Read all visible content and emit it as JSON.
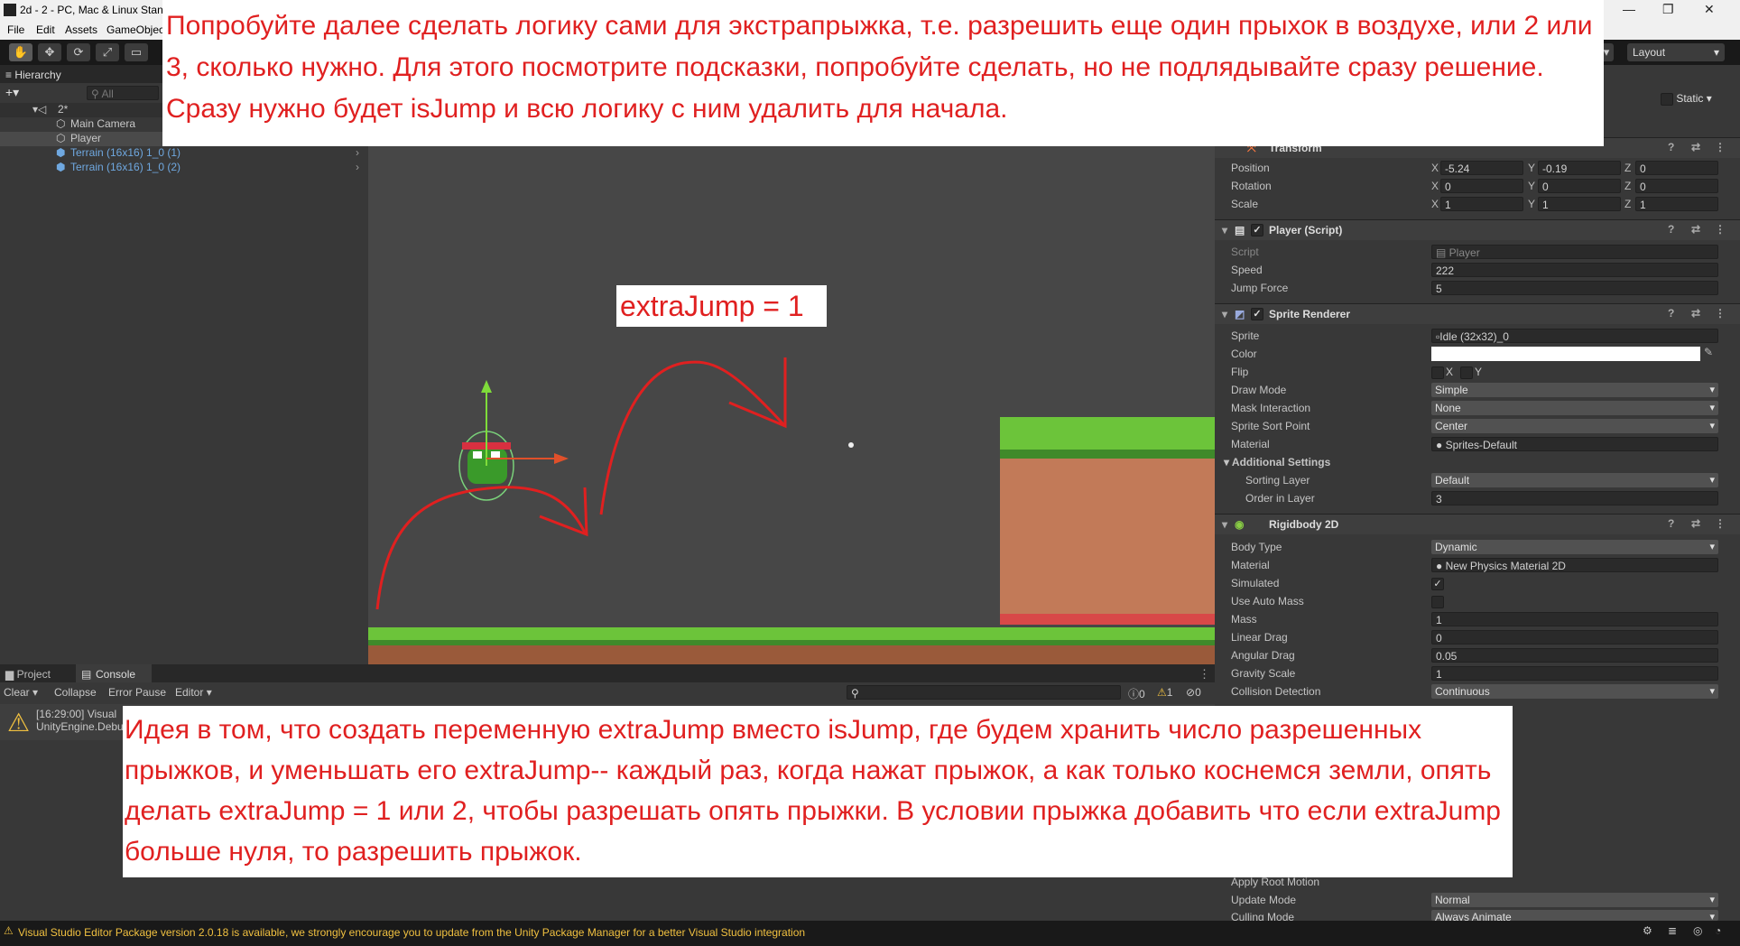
{
  "window": {
    "title": "2d - 2 - PC, Mac & Linux Stan"
  },
  "menu": [
    "File",
    "Edit",
    "Assets",
    "GameObjec"
  ],
  "toolbar": {
    "layout_label": "Layout"
  },
  "hierarchy": {
    "tab_label": "Hierarchy",
    "search_placeholder": "All",
    "scene_name": "2*",
    "items": [
      "Main Camera",
      "Player",
      "Terrain (16x16) 1_0 (1)",
      "Terrain (16x16) 1_0 (2)"
    ]
  },
  "inspector": {
    "static_label": "Static",
    "transform": {
      "header": "Transform",
      "position_label": "Position",
      "position": {
        "x": "-5.24",
        "y": "-0.19",
        "z": "0"
      },
      "rotation_label": "Rotation",
      "rotation": {
        "x": "0",
        "y": "0",
        "z": "0"
      },
      "scale_label": "Scale",
      "scale": {
        "x": "1",
        "y": "1",
        "z": "1"
      }
    },
    "player_script": {
      "header": "Player (Script)",
      "script_label": "Script",
      "script_value": "Player",
      "speed_label": "Speed",
      "speed_value": "222",
      "jump_label": "Jump Force",
      "jump_value": "5"
    },
    "sprite_renderer": {
      "header": "Sprite Renderer",
      "sprite_label": "Sprite",
      "sprite_value": "Idle (32x32)_0",
      "color_label": "Color",
      "flip_label": "Flip",
      "flip_x": "X",
      "flip_y": "Y",
      "draw_mode_label": "Draw Mode",
      "draw_mode_value": "Simple",
      "mask_label": "Mask Interaction",
      "mask_value": "None",
      "sort_point_label": "Sprite Sort Point",
      "sort_point_value": "Center",
      "material_label": "Material",
      "material_value": "Sprites-Default",
      "additional_label": "Additional Settings",
      "sorting_layer_label": "Sorting Layer",
      "sorting_layer_value": "Default",
      "order_label": "Order in Layer",
      "order_value": "3"
    },
    "rigidbody": {
      "header": "Rigidbody 2D",
      "body_type_label": "Body Type",
      "body_type_value": "Dynamic",
      "material_label": "Material",
      "material_value": "New Physics Material 2D",
      "simulated_label": "Simulated",
      "auto_mass_label": "Use Auto Mass",
      "mass_label": "Mass",
      "mass_value": "1",
      "linear_drag_label": "Linear Drag",
      "linear_drag_value": "0",
      "angular_drag_label": "Angular Drag",
      "angular_drag_value": "0.05",
      "gravity_label": "Gravity Scale",
      "gravity_value": "1",
      "collision_label": "Collision Detection",
      "collision_value": "Continuous"
    },
    "animator": {
      "apply_root_label": "Apply Root Motion",
      "update_mode_label": "Update Mode",
      "update_mode_value": "Normal",
      "culling_label": "Culling Mode",
      "culling_value": "Always Animate"
    }
  },
  "bottom": {
    "project_tab": "Project",
    "console_tab": "Console",
    "clear": "Clear",
    "collapse": "Collapse",
    "error_pause": "Error Pause",
    "editor": "Editor",
    "count_info": "0",
    "count_warn": "1",
    "count_err": "0",
    "log_line1": "[16:29:00] Visual",
    "log_line2": "UnityEngine.Debu"
  },
  "status_bar": {
    "message": "Visual Studio Editor Package version 2.0.18 is available, we strongly encourage you to update from the Unity Package Manager for a better Visual Studio integration"
  },
  "annotations": {
    "top": "Попробуйте далее сделать логику сами для экстрапрыжка, т.е. разрешить еще один прыхок в воздухе, или 2 или 3, сколько нужно. Для этого посмотрите подсказки, попробуйте сделать, но не подлядывайте сразу решение. Сразу нужно будет isJump и всю логику с ним удалить для начала.",
    "label": "extraJump = 1",
    "bottom": "Идея в том, что создать переменную extraJump вместо isJump, где будем хранить число разрешенных прыжков, и уменьшать его extraJump-- каждый раз, когда нажат прыжок, а как только коснемся земли, опять делать extraJump = 1 или 2, чтобы разрешать опять прыжки. В условии прыжка добавить что если extraJump больше нуля, то разрешить прыжок."
  },
  "colors": {
    "annotation_red": "#e02020",
    "grass": "#6cc43a",
    "dirt": "#c07050"
  }
}
